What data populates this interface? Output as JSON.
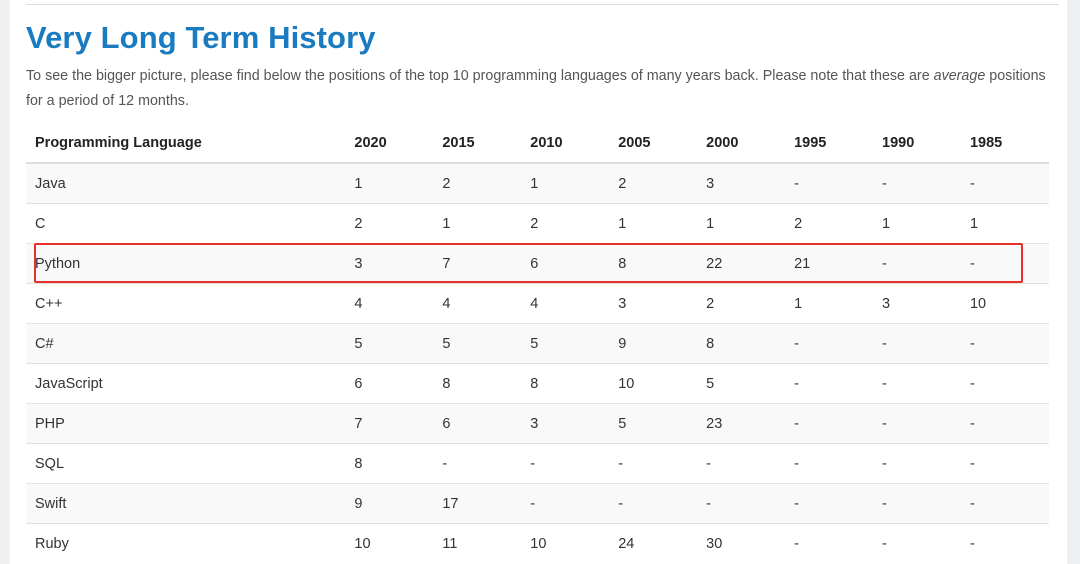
{
  "page": {
    "title": "Very Long Term History",
    "intro_before_em": "To see the bigger picture, please find below the positions of the top 10 programming languages of many years back. Please note that these are ",
    "intro_em": "average",
    "intro_after_em": " positions for a period of 12 months."
  },
  "table": {
    "headers": [
      "Programming Language",
      "2020",
      "2015",
      "2010",
      "2005",
      "2000",
      "1995",
      "1990",
      "1985"
    ],
    "rows": [
      [
        "Java",
        "1",
        "2",
        "1",
        "2",
        "3",
        "-",
        "-",
        "-"
      ],
      [
        "C",
        "2",
        "1",
        "2",
        "1",
        "1",
        "2",
        "1",
        "1"
      ],
      [
        "Python",
        "3",
        "7",
        "6",
        "8",
        "22",
        "21",
        "-",
        "-"
      ],
      [
        "C++",
        "4",
        "4",
        "4",
        "3",
        "2",
        "1",
        "3",
        "10"
      ],
      [
        "C#",
        "5",
        "5",
        "5",
        "9",
        "8",
        "-",
        "-",
        "-"
      ],
      [
        "JavaScript",
        "6",
        "8",
        "8",
        "10",
        "5",
        "-",
        "-",
        "-"
      ],
      [
        "PHP",
        "7",
        "6",
        "3",
        "5",
        "23",
        "-",
        "-",
        "-"
      ],
      [
        "SQL",
        "8",
        "-",
        "-",
        "-",
        "-",
        "-",
        "-",
        "-"
      ],
      [
        "Swift",
        "9",
        "17",
        "-",
        "-",
        "-",
        "-",
        "-",
        "-"
      ],
      [
        "Ruby",
        "10",
        "11",
        "10",
        "24",
        "30",
        "-",
        "-",
        "-"
      ]
    ],
    "highlighted_row": "Python"
  },
  "colors": {
    "title": "#1a7bc0",
    "highlight_border": "#e8302a",
    "stripe": "#f9f9f9"
  }
}
